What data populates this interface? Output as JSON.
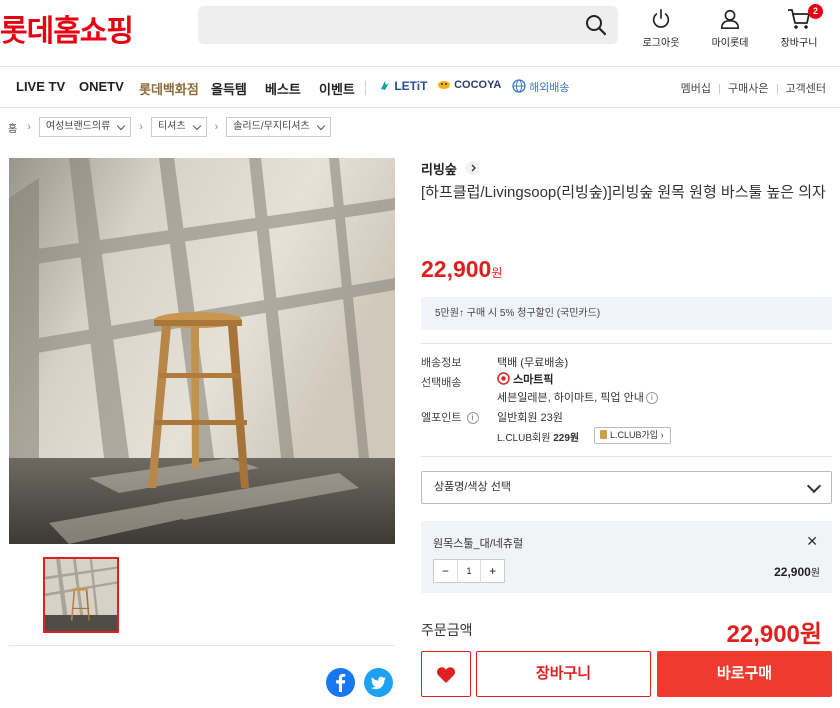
{
  "header": {
    "logo": "롯데홈쇼핑",
    "search": {
      "value": "",
      "placeholder": ""
    },
    "logout_label": "로그아웃",
    "mypage_label": "마이롯데",
    "cart_label": "장바구니",
    "cart_count": "2"
  },
  "nav": {
    "items": [
      "LIVE TV",
      "ONETV",
      "롯데백화점",
      "올득템",
      "베스트",
      "이벤트",
      "LETiT",
      "COCOYA",
      "해외배송"
    ],
    "accent_color": "#8b6d3c",
    "right": [
      "멤버십",
      "구매사은",
      "고객센터"
    ]
  },
  "breadcrumb": {
    "home": "홈",
    "levels": [
      "여성브랜드의류",
      "티셔츠",
      "솔리드/무지티셔츠"
    ]
  },
  "product": {
    "brand": "리빙숲",
    "title": "[하프클럽/Livingsoop(리빙숲)]리빙숲 원목 원형 바스툴 높은 의자",
    "price": "22,900",
    "price_unit": "원",
    "promo": "5만원↑ 구매 시 5% 청구할인 (국민카드)",
    "shipping_label": "배송정보",
    "shipping_value": "택배 (무료배송)",
    "pickup_label": "선택배송",
    "pickup_brand": "스마트픽",
    "pickup_value": "세븐일레븐, 하이마트, 픽업 안내",
    "point_label": "엘포인트",
    "point_general": "일반회원 23원",
    "point_lclub_prefix": "L.CLUB회원",
    "point_lclub_value": "229원",
    "lclub_join": "L.CLUB가입"
  },
  "option": {
    "select_placeholder": "상품명/색상 선택",
    "selected_name": "원목스툴_대/네츄럴",
    "quantity": "1",
    "line_price": "22,900",
    "line_price_unit": "원",
    "close_glyph": "✕",
    "minus_glyph": "−",
    "plus_glyph": "+"
  },
  "order": {
    "total_label": "주문금액",
    "total_price": "22,900원",
    "cart_button": "장바구니",
    "buy_button": "바로구매"
  },
  "colors": {
    "brand_red": "#e60012",
    "price_red": "#e02020",
    "buy_button": "#ee3a2f",
    "facebook": "#1877f2",
    "twitter": "#1da1f2"
  }
}
